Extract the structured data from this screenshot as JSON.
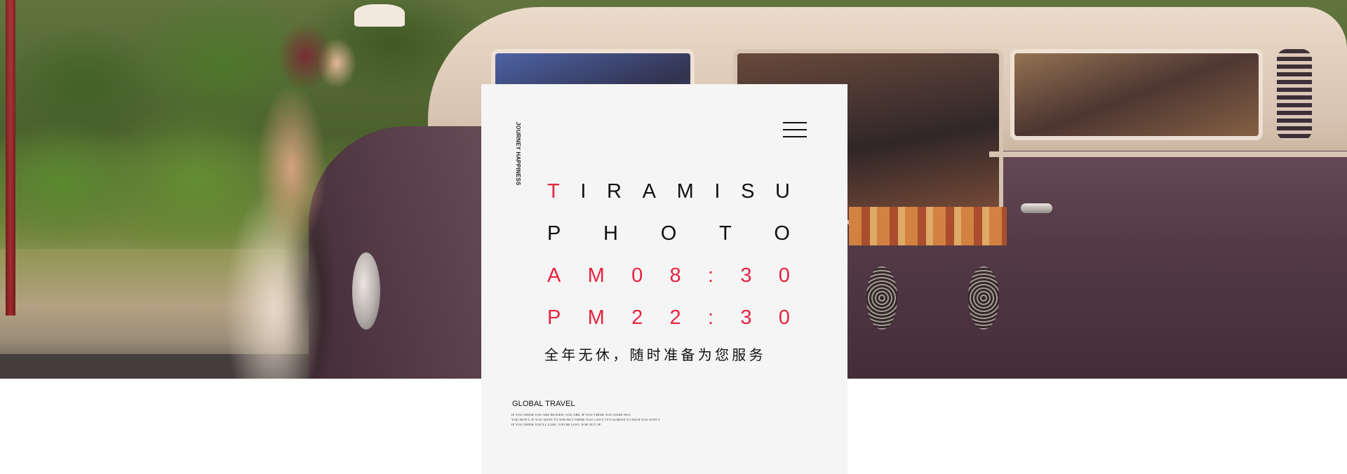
{
  "banner": {
    "icons": [
      "couple-photo",
      "vintage-van"
    ]
  },
  "card": {
    "vertical_tag": "JOURNEY HAPPINESS",
    "brand_first": "T",
    "brand_rest": [
      "I",
      "R",
      "A",
      "M",
      "I",
      "S",
      "U"
    ],
    "photo_letters": [
      "P",
      "H",
      "O",
      "T",
      "O"
    ],
    "am_hours": [
      "A",
      "M",
      "0",
      "8",
      ":",
      "3",
      "0"
    ],
    "pm_hours": [
      "P",
      "M",
      "2",
      "2",
      ":",
      "3",
      "0"
    ],
    "slogan": "全年无休，随时准备为您服务",
    "global_title": "GLOBAL TRAVEL",
    "fine_print": [
      "IF YOU THINK YOU ARE BEATEN, YOU ARE, IF YOU THINK YOU DARE NOT,",
      "YOU DON'T, IF YOU WANT TO WIN BUT THINK YOU CAN'T, IT'S ALMOST A CINCH YOU WON'T.",
      "IF YOU THINK YOU'LL LOSE, YOU'RE LOST; FOR OUT OF"
    ]
  },
  "colors": {
    "accent": "#e8233f",
    "card_bg": "#f5f5f6",
    "text": "#111111"
  }
}
